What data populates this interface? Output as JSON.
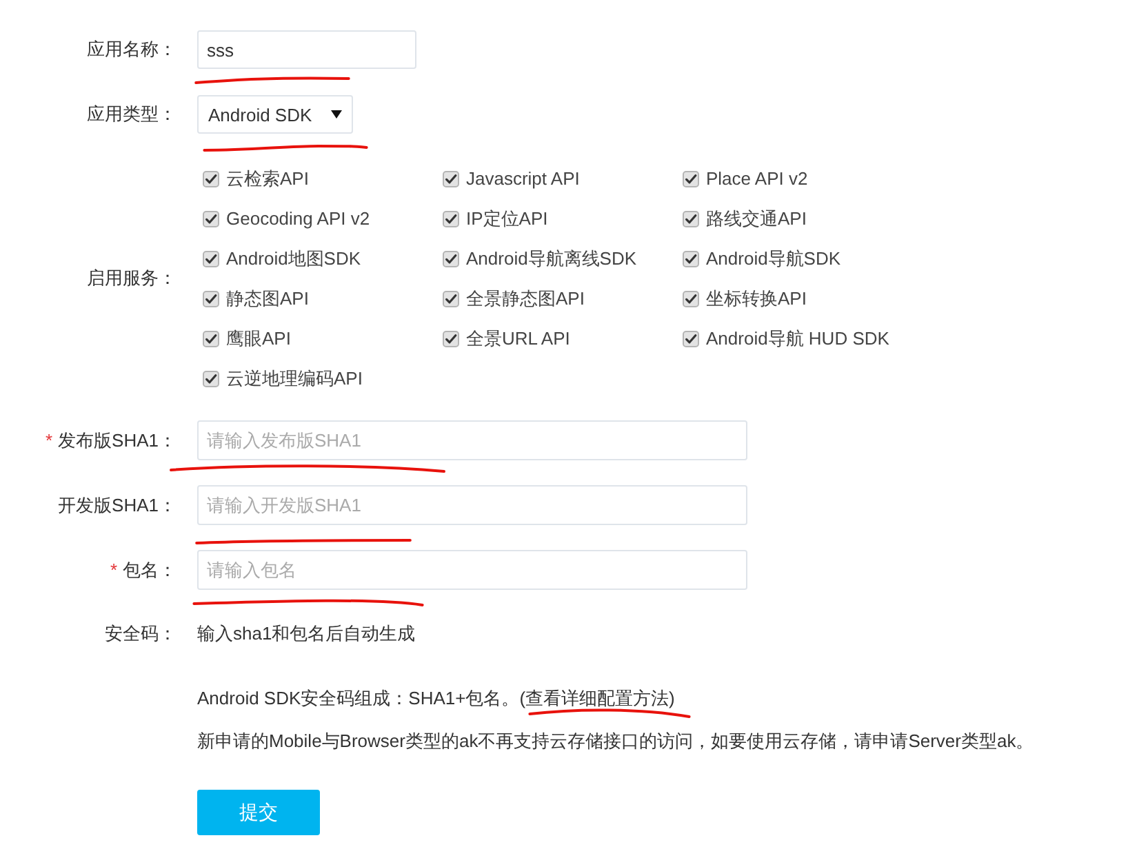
{
  "fields": [
    {
      "kind": "text_input",
      "label": "应用名称：",
      "value": "sss",
      "underlined": true
    },
    {
      "kind": "select",
      "label": "应用类型：",
      "value": "Android SDK",
      "underlined": true
    },
    {
      "kind": "checkbox_group",
      "label": "启用服务：",
      "underlined": false,
      "items": [
        {
          "label": "云检索API",
          "checked": true
        },
        {
          "label": "Javascript API",
          "checked": true
        },
        {
          "label": "Place API v2",
          "checked": true
        },
        {
          "label": "Geocoding API v2",
          "checked": true
        },
        {
          "label": "IP定位API",
          "checked": true
        },
        {
          "label": "路线交通API",
          "checked": true
        },
        {
          "label": "Android地图SDK",
          "checked": true
        },
        {
          "label": "Android导航离线SDK",
          "checked": true
        },
        {
          "label": "Android导航SDK",
          "checked": true
        },
        {
          "label": "静态图API",
          "checked": true
        },
        {
          "label": "全景静态图API",
          "checked": true
        },
        {
          "label": "坐标转换API",
          "checked": true
        },
        {
          "label": "鹰眼API",
          "checked": true
        },
        {
          "label": "全景URL API",
          "checked": true
        },
        {
          "label": "Android导航 HUD SDK",
          "checked": true
        },
        {
          "label": "云逆地理编码API",
          "checked": true
        }
      ]
    },
    {
      "kind": "text_input",
      "required_mark": "*",
      "label": "发布版SHA1：",
      "placeholder": "请输入发布版SHA1",
      "underlined": true
    },
    {
      "kind": "text_input",
      "label": "开发版SHA1：",
      "placeholder": "请输入开发版SHA1",
      "underlined": true
    },
    {
      "kind": "text_input",
      "required_mark": "*",
      "label": "包名：",
      "placeholder": "请输入包名",
      "underlined": true
    },
    {
      "kind": "static",
      "label": "安全码：",
      "value": "输入sha1和包名后自动生成",
      "underlined": false
    }
  ],
  "notes": [
    {
      "text": "Android SDK安全码组成：SHA1+包名。",
      "link": {
        "text": "(查看详细配置方法)",
        "underlined": true
      }
    },
    {
      "text": "新申请的Mobile与Browser类型的ak不再支持云存储接口的访问，如要使用云存储，请申请Server类型ak。"
    }
  ],
  "submit_button": {
    "label": "提交"
  }
}
